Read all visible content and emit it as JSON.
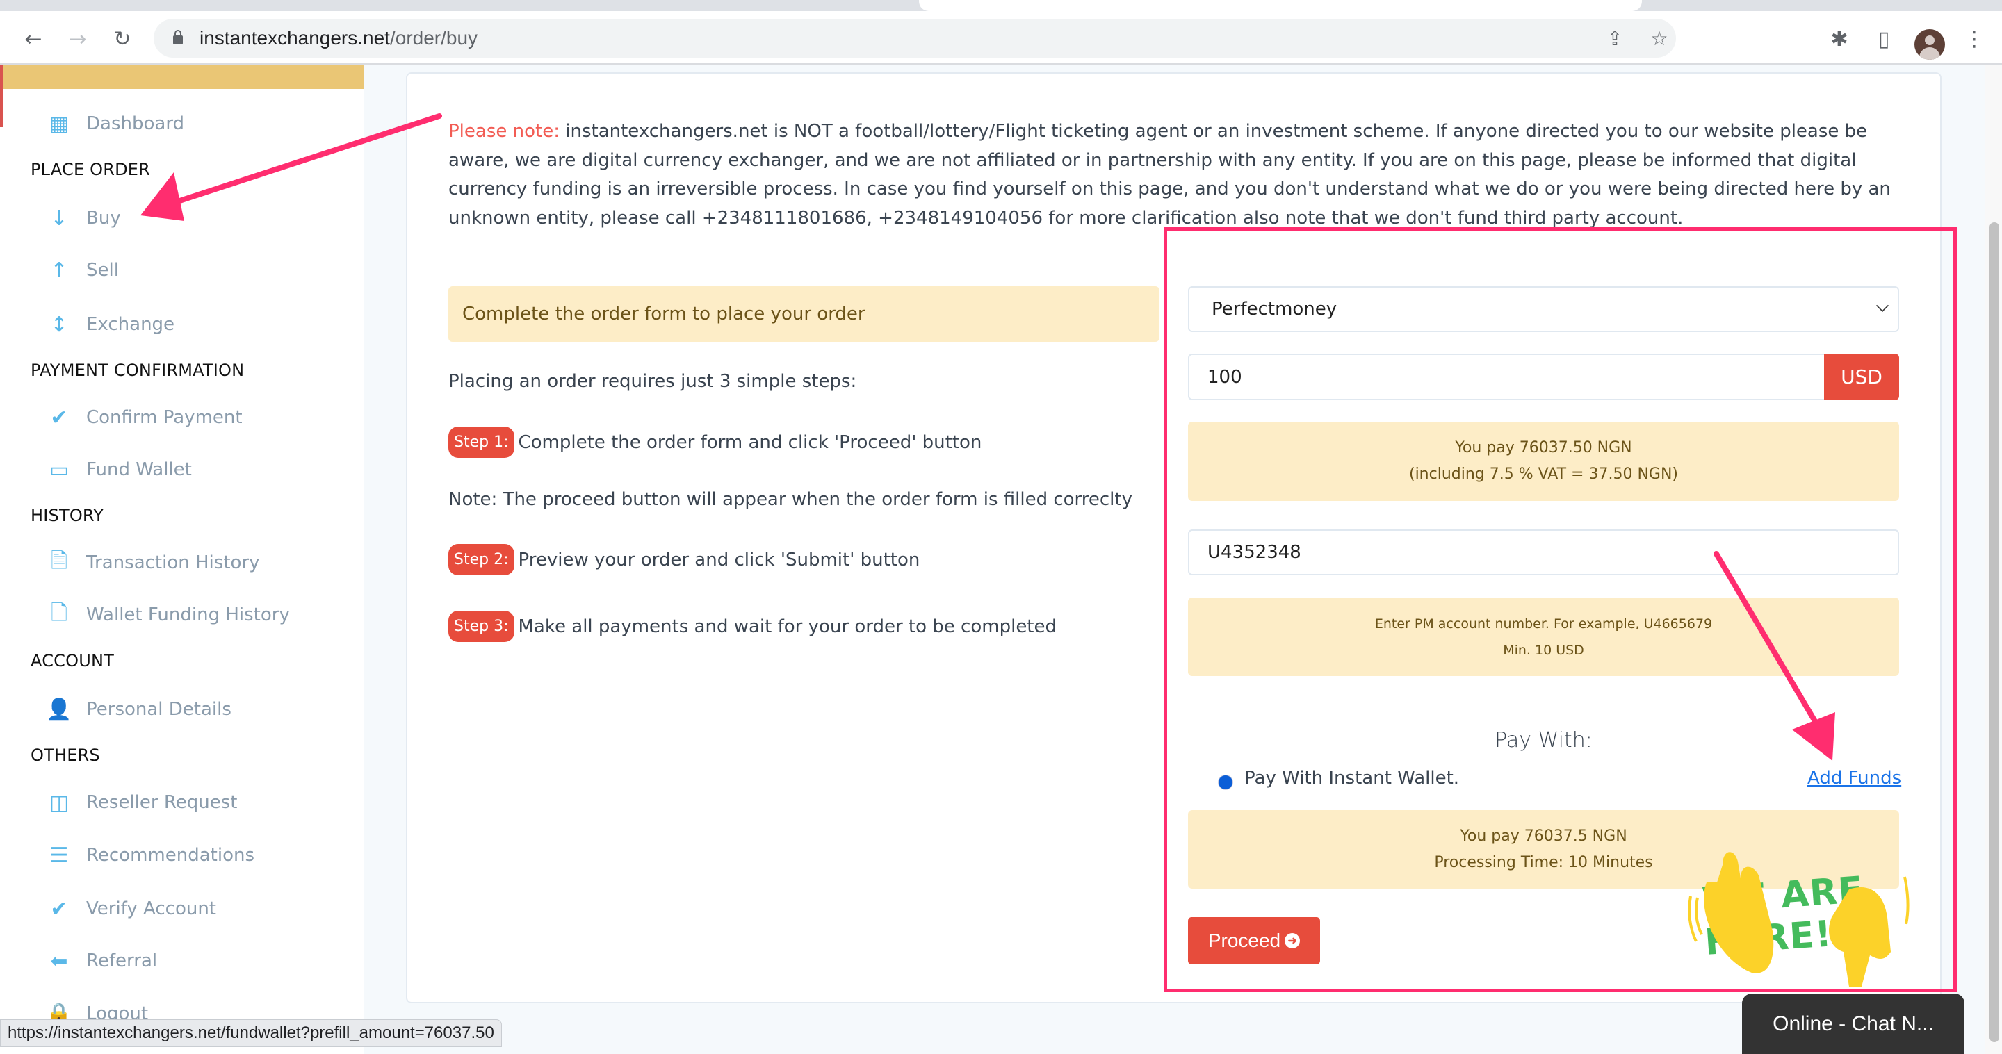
{
  "browser": {
    "url_host": "instantexchangers.net",
    "url_path": "/order/buy",
    "status_url": "https://instantexchangers.net/fundwallet?prefill_amount=76037.50",
    "icons": {
      "back": "←",
      "forward": "→",
      "reload": "↻",
      "share": "⇪",
      "bookmark": "☆",
      "extensions": "✱",
      "sidepanel": "▯",
      "menu": "⋮"
    }
  },
  "sidebar": {
    "items": [
      {
        "type": "item",
        "label": "Dashboard",
        "icon": "grid-icon"
      },
      {
        "type": "header",
        "label": "PLACE ORDER"
      },
      {
        "type": "item",
        "label": "Buy",
        "icon": "arrow-down-icon"
      },
      {
        "type": "item",
        "label": "Sell",
        "icon": "arrow-up-icon"
      },
      {
        "type": "item",
        "label": "Exchange",
        "icon": "arrows-vertical-icon"
      },
      {
        "type": "header",
        "label": "PAYMENT CONFIRMATION"
      },
      {
        "type": "item",
        "label": "Confirm Payment",
        "icon": "check-icon"
      },
      {
        "type": "item",
        "label": "Fund Wallet",
        "icon": "credit-card-icon"
      },
      {
        "type": "header",
        "label": "HISTORY"
      },
      {
        "type": "item",
        "label": "Transaction History",
        "icon": "document-icon"
      },
      {
        "type": "item",
        "label": "Wallet Funding History",
        "icon": "file-icon"
      },
      {
        "type": "header",
        "label": "ACCOUNT"
      },
      {
        "type": "item",
        "label": "Personal Details",
        "icon": "user-icon"
      },
      {
        "type": "header",
        "label": "OTHERS"
      },
      {
        "type": "item",
        "label": "Reseller Request",
        "icon": "columns-icon"
      },
      {
        "type": "item",
        "label": "Recommendations",
        "icon": "list-icon"
      },
      {
        "type": "item",
        "label": "Verify Account",
        "icon": "check-icon"
      },
      {
        "type": "item",
        "label": "Referral",
        "icon": "arrow-left-icon"
      },
      {
        "type": "item",
        "label": "Logout",
        "icon": "lock-icon"
      }
    ]
  },
  "notice": {
    "label": "Please note:",
    "text": " instantexchangers.net is NOT a football/lottery/Flight ticketing agent or an investment scheme. If anyone directed you to our website please be aware, we are digital currency exchanger, and we are not affiliated or in partnership with any entity. If you are on this page, please be informed that digital currency funding is an irreversible process. In case you find yourself on this page, and you don't understand what we do or you were being directed here by an unknown entity, please call +2348111801686, +2348149104056 for more clarification also note that we don't fund third party account."
  },
  "instructions": {
    "alert": "Complete the order form to place your order",
    "intro": "Placing an order requires just 3 simple steps:",
    "step1_badge": "Step 1:",
    "step1_text": "Complete the order form and click 'Proceed' button",
    "note": "Note: The proceed button will appear when the order form is filled correclty",
    "step2_badge": "Step 2:",
    "step2_text": "Preview your order and click 'Submit' button",
    "step3_badge": "Step 3:",
    "step3_text": "Make all payments and wait for your order to be completed"
  },
  "form": {
    "currency_selected": "Perfectmoney",
    "amount_value": "100",
    "amount_unit": "USD",
    "pay_line1": "You pay 76037.50 NGN",
    "pay_line2": "(including 7.5 % VAT = 37.50 NGN)",
    "pm_account_value": "U4352348",
    "hint_line1": "Enter PM account number. For example, U4665679",
    "hint_line2": "Min. 10 USD",
    "pay_with_heading": "Pay With:",
    "wallet_option": "Pay With Instant Wallet.",
    "add_funds": "Add Funds",
    "summary_line1": "You pay 76037.5 NGN",
    "summary_line2": "Processing Time: 10 Minutes",
    "proceed_label": "Proceed"
  },
  "annotations": {
    "callout": "WE ARE HERE!"
  },
  "chat": {
    "label": "Online - Chat N..."
  },
  "colors": {
    "accent_red": "#e74c3c",
    "annotation_pink": "#ff2d6f",
    "sidebar_icon": "#5ab8e8",
    "brand_bar": "#eac675",
    "alert_bg": "#fdedc7",
    "link_blue": "#1a73e8"
  }
}
